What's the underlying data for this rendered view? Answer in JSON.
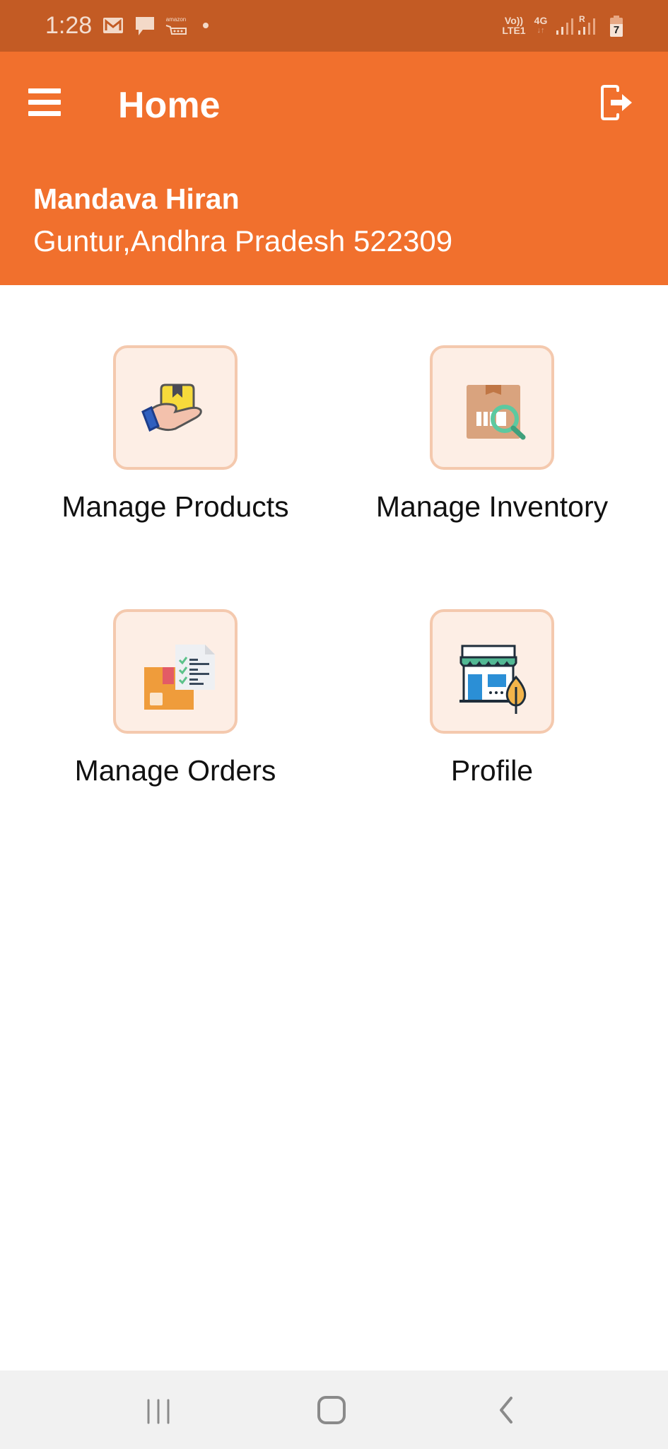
{
  "status_bar": {
    "time": "1:28",
    "notification_icons": [
      "gmail-icon",
      "message-icon",
      "amazon-icon",
      "dot-icon"
    ],
    "system_icons": [
      "volte-lte1-icon",
      "4g-data-icon",
      "signal-icon",
      "roaming-signal-icon",
      "battery-charging-icon"
    ],
    "volte_label": "Vo))",
    "lte_label": "LTE1",
    "network_label": "4G",
    "roaming_label": "R",
    "battery_level": "7",
    "amazon_label": "amazon"
  },
  "app_bar": {
    "title": "Home",
    "menu_icon": "hamburger-menu-icon",
    "logout_icon": "logout-icon"
  },
  "user": {
    "name": "Mandava Hiran",
    "address": "Guntur,Andhra Pradesh 522309"
  },
  "menu_items": [
    {
      "label": "Manage Products",
      "icon": "hand-box-icon"
    },
    {
      "label": "Manage Inventory",
      "icon": "box-search-icon"
    },
    {
      "label": "Manage Orders",
      "icon": "box-checklist-icon"
    },
    {
      "label": "Profile",
      "icon": "store-icon"
    }
  ],
  "colors": {
    "status_bar": "#c35b24",
    "app_bar": "#f1702d",
    "tile_bg": "#fdeee5",
    "tile_border": "#f4c9ae",
    "nav_bar": "#f1f1f1"
  },
  "nav_bar": {
    "buttons": [
      "recent-apps-icon",
      "home-icon",
      "back-icon"
    ]
  }
}
